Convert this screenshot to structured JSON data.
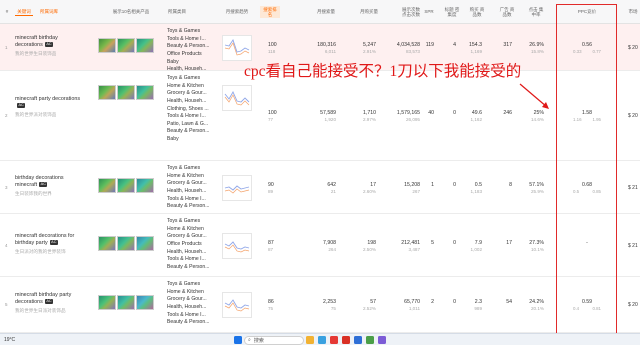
{
  "header": {
    "row_index_label": "#",
    "keyword": "关键词",
    "related_word": "所属词库",
    "top_products": "展示10名相关产品",
    "category": "所属类目",
    "monthly_trend": "月搜索趋势",
    "rank": "搜索排名",
    "monthly_search": "月搜索量",
    "monthly_purchase": "月购买量",
    "impressions_clicks": "展示次数 点击次数",
    "spr": "SPR",
    "title_density": "标题 密集度",
    "product_count": "购买 商品数",
    "ad_product_count": "广告 商品数",
    "click_share": "点击 集中率",
    "ppc": "PPC竞价",
    "right_col": "市场"
  },
  "rows": [
    {
      "index": "1",
      "keyword": "minecraft birthday decorations",
      "badge": "AC",
      "translation": "我的世界生日装饰品",
      "categories": [
        "Toys & Games",
        "Tools & Home I...",
        "Beauty & Person...",
        "Office Products",
        "Baby",
        "Health, Househ...",
        "Handmade"
      ],
      "rank": "100",
      "rank_sub": "118",
      "search": "180,316",
      "search_sub": "6,011",
      "purchase": "5,247",
      "purchase_sub": "2.91%",
      "impressions": "4,034,528",
      "impressions_sub": "83,573",
      "spr": "119",
      "title_density": "4",
      "product_count": "154.3",
      "product_sub": "1,169",
      "ad_count": "317",
      "click_share": "26.9%",
      "click_sub": "15.8%",
      "ppc_mid": "0.56",
      "ppc_low": "0.33",
      "ppc_high": "0.77",
      "right": "$ 20",
      "trend": [
        0.65,
        0.6,
        0.9,
        0.3,
        0.35,
        0.5,
        0.4
      ]
    },
    {
      "index": "2",
      "keyword": "minecraft party decorations",
      "badge": "AC",
      "translation": "我的世界派对装饰品",
      "categories": [
        "Toys & Games",
        "Home & Kitchen",
        "Grocery & Gour...",
        "Health, Househ...",
        "Clothing, Shoes ...",
        "Tools & Home I...",
        "Patio, Lawn & G...",
        "Beauty & Person...",
        "Baby"
      ],
      "rank": "100",
      "rank_sub": "77",
      "search": "57,589",
      "search_sub": "1,920",
      "purchase": "1,710",
      "purchase_sub": "2.97%",
      "impressions": "1,579,165",
      "impressions_sub": "26,095",
      "spr": "40",
      "title_density": "0",
      "product_count": "49.6",
      "product_sub": "1,162",
      "ad_count": "246",
      "click_share": "25%",
      "click_sub": "14.6%",
      "ppc_mid": "1.58",
      "ppc_low": "1.16",
      "ppc_high": "1.95",
      "right": "$ 20",
      "trend": [
        0.7,
        0.45,
        0.8,
        0.35,
        0.3,
        0.5,
        0.3
      ]
    },
    {
      "index": "3",
      "keyword": "birthday decorations minecraft",
      "badge": "AC",
      "translation": "生日装饰我的世界",
      "categories": [
        "Toys & Games",
        "Home & Kitchen",
        "Grocery & Gour...",
        "Health, Househ...",
        "Tools & Home I...",
        "Beauty & Person..."
      ],
      "rank": "90",
      "rank_sub": "89",
      "search": "642",
      "search_sub": "21",
      "purchase": "17",
      "purchase_sub": "2.60%",
      "impressions": "15,208",
      "impressions_sub": "267",
      "spr": "1",
      "title_density": "0",
      "product_count": "0.5",
      "product_sub": "1,183",
      "ad_count": "8",
      "click_share": "57.1%",
      "click_sub": "25.9%",
      "ppc_mid": "0.68",
      "ppc_low": "0.5",
      "ppc_high": "0.85",
      "right": "$ 21",
      "trend": [
        0.5,
        0.55,
        0.4,
        0.6,
        0.45,
        0.5,
        0.55
      ]
    },
    {
      "index": "4",
      "keyword": "minecraft decorations for birthday party",
      "badge": "AC",
      "translation": "生日派对的我的世界装饰",
      "categories": [
        "Toys & Games",
        "Home & Kitchen",
        "Grocery & Gour...",
        "Office Products",
        "Health, Househ...",
        "Tools & Home I...",
        "Beauty & Person..."
      ],
      "rank": "87",
      "rank_sub": "87",
      "search": "7,908",
      "search_sub": "264",
      "purchase": "198",
      "purchase_sub": "2.50%",
      "impressions": "212,481",
      "impressions_sub": "3,487",
      "spr": "5",
      "title_density": "0",
      "product_count": "7.9",
      "product_sub": "1,002",
      "ad_count": "17",
      "click_share": "27.3%",
      "click_sub": "10.1%",
      "ppc_mid": "-",
      "ppc_low": "",
      "ppc_high": "",
      "right": "$ 21",
      "trend": [
        0.6,
        0.5,
        0.7,
        0.4,
        0.35,
        0.45,
        0.4
      ]
    },
    {
      "index": "5",
      "keyword": "minecraft birthday party decorations",
      "badge": "AC",
      "translation": "我的世界生日派对装饰品",
      "categories": [
        "Toys & Games",
        "Home & Kitchen",
        "Grocery & Gour...",
        "Health, Househ...",
        "Tools & Home I...",
        "Beauty & Person..."
      ],
      "rank": "86",
      "rank_sub": "75",
      "search": "2,253",
      "search_sub": "75",
      "purchase": "57",
      "purchase_sub": "2.52%",
      "impressions": "65,770",
      "impressions_sub": "1,011",
      "spr": "2",
      "title_density": "0",
      "product_count": "2.3",
      "product_sub": "989",
      "ad_count": "54",
      "click_share": "24.2%",
      "click_sub": "20.1%",
      "ppc_mid": "0.59",
      "ppc_low": "0.4",
      "ppc_high": "0.81",
      "right": "$ 20",
      "trend": [
        0.6,
        0.5,
        0.75,
        0.4,
        0.35,
        0.5,
        0.45
      ]
    }
  ],
  "annotation": {
    "text": "cpc看自己能接受不？1刀以下我能接受的",
    "color": "#e01818"
  },
  "taskbar": {
    "weather": "19°C",
    "search_placeholder": "搜索"
  },
  "colors": {
    "accent": "#ff6a00",
    "highlight_row": "#fef0f0",
    "annotation": "#e12a2a",
    "trend_line": "#8fa6e8"
  }
}
